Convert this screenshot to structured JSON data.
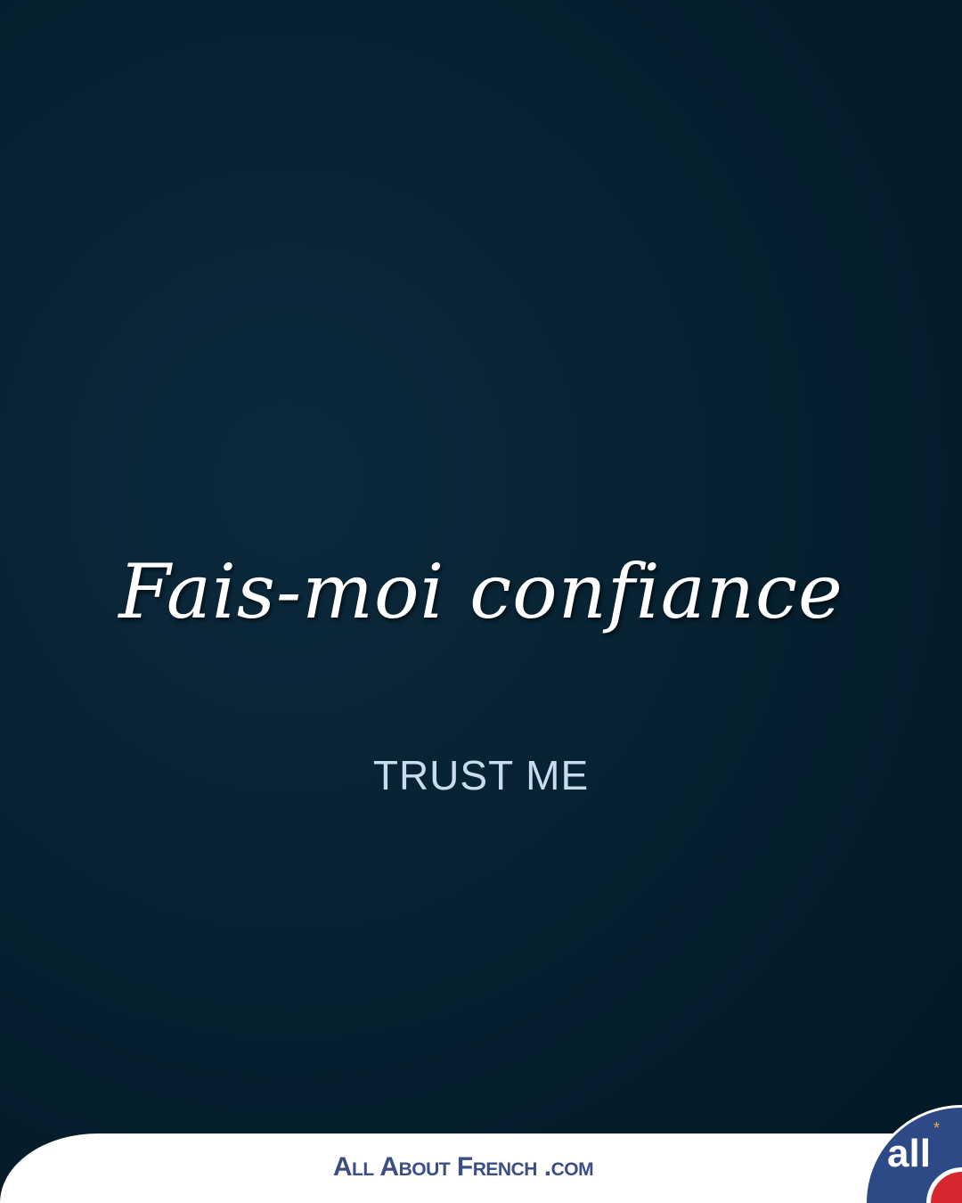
{
  "phrase": "Fais-moi confiance",
  "translation": "TRUST ME",
  "footer": {
    "brand": "All About French .com",
    "logo_text": "all",
    "logo_star": "*"
  },
  "colors": {
    "background": "#06202f",
    "brand": "#3b4f86",
    "logo_blue": "#2e4a86",
    "logo_red": "#d7262e"
  }
}
